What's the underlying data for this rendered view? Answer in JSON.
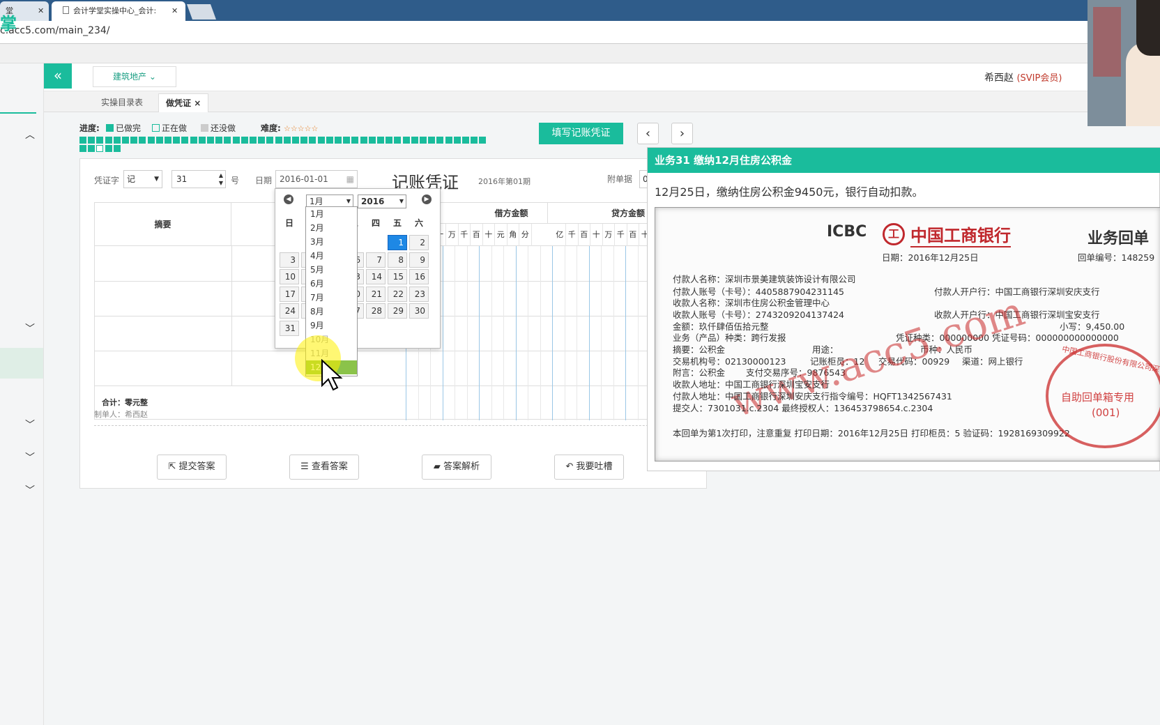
{
  "browser": {
    "tab_partial": "堂",
    "tab_title": "会计学堂实操中心_会计:",
    "address": "c.acc5.com/main_234/",
    "logo_partial": "掌"
  },
  "header": {
    "industry": "建筑地产",
    "user": "希西赵",
    "member": "(SVIP会员)"
  },
  "subtabs": {
    "tab1": "实操目录表",
    "tab2": "做凭证",
    "close": "×"
  },
  "progress": {
    "label": "进度:",
    "done": "已做完",
    "doing": "正在做",
    "todo": "还没做",
    "difficulty": "难度:",
    "stars": "☆☆☆☆☆",
    "done_count": 50,
    "total_count": 53
  },
  "toolbar": {
    "fill_button": "填写记账凭证",
    "prev": "‹",
    "next": "›"
  },
  "voucher": {
    "word_label": "凭证字",
    "word": "记",
    "number": "31",
    "hao": "号",
    "date_label": "日期",
    "date": "2016-01-01",
    "title": "记账凭证",
    "period": "2016年第01期",
    "attach_label": "附单据",
    "attach_value": "0",
    "summary_col": "摘要",
    "debit": "借方金额",
    "credit": "贷方金额",
    "total": "合计：零元整",
    "maker": "制单人：希西赵"
  },
  "digits": [
    "亿",
    "千",
    "百",
    "十",
    "万",
    "千",
    "百",
    "十",
    "元",
    "角",
    "分"
  ],
  "calendar": {
    "month_select": "1月",
    "year_select": "2016",
    "weekdays": [
      "日",
      "一",
      "二",
      "三",
      "四",
      "五",
      "六"
    ],
    "days": [
      "1",
      "2",
      "3",
      "4",
      "5",
      "6",
      "7",
      "8",
      "9",
      "10",
      "11",
      "12",
      "13",
      "14",
      "15",
      "16",
      "17",
      "18",
      "19",
      "20",
      "21",
      "22",
      "23",
      "24",
      "25",
      "26",
      "27",
      "28",
      "29",
      "30",
      "31"
    ],
    "months": [
      "1月",
      "2月",
      "3月",
      "4月",
      "5月",
      "6月",
      "7月",
      "8月",
      "9月",
      "10月",
      "11月",
      "12月"
    ]
  },
  "actions": {
    "submit": "提交答案",
    "view": "查看答案",
    "analysis": "答案解析",
    "feedback": "我要吐槽"
  },
  "task": {
    "title": "业务31 缴纳12月住房公积金",
    "description": "12月25日，缴纳住房公积金9450元，银行自动扣款。"
  },
  "receipt": {
    "icbc": "ICBC",
    "bank": "中国工商银行",
    "type": "业务回单",
    "date": "日期：2016年12月25日",
    "receipt_no": "回单编号：148259",
    "lines": [
      "付款人名称：深圳市景美建筑装饰设计有限公司",
      "付款人账号（卡号）：4405887904231145",
      "收款人名称：深圳市住房公积金管理中心",
      "收款人账号（卡号）：2743209204137424",
      "金额：玖仟肆佰伍拾元整",
      "业务（产品）种类：跨行发报",
      "摘要：公积金",
      "交易机构号：02130000123",
      "附言：公积金",
      "收款人地址：中国工商银行深圳宝安支行",
      "付款人地址：中国工商银行深圳安庆支行指令编号：HQFT1342567431",
      "提交人：7301031.c.2304 最终授权人：136453798654.c.2304"
    ],
    "payer_bank": "付款人开户行：中国工商银行深圳安庆支行",
    "payee_bank": "收款人开户行：中国工商银行深圳宝安支行",
    "small_amount": "小写：9,450.00",
    "voucher_type": "凭证种类：000000000 凭证号码：000000000000000",
    "usage": "用途：",
    "currency": "币种：人民币",
    "teller": "记账柜员：12",
    "trade_code": "交易代码：00929",
    "channel": "渠道：网上银行",
    "serial": "支付交易序号：9876543",
    "footer": "本回单为第1次打印，注意重复 打印日期：2016年12月25日 打印柜员：5 验证码：1928169309922",
    "watermark": "www.acc5.com",
    "seal": "中国工商银行股份有限公司深",
    "seal2": "自助回单箱专用",
    "seal3": "(001)"
  }
}
